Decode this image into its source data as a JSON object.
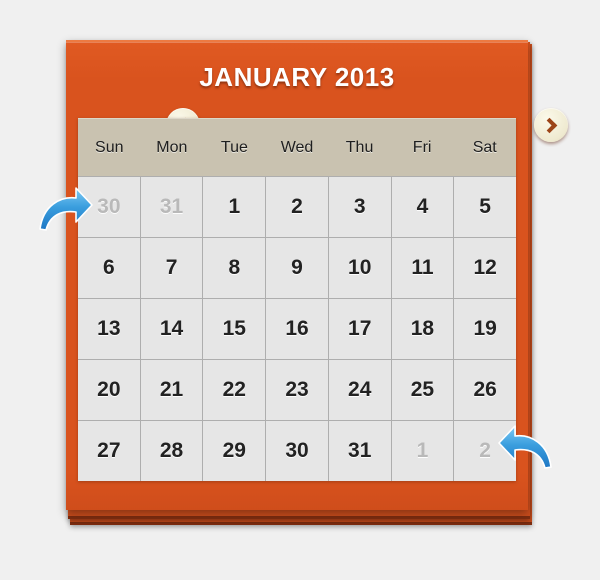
{
  "page": {
    "background_color": "#f0f0f0"
  },
  "calendar": {
    "accent_color": "#d9531e",
    "header": {
      "title": "JANUARY 2013",
      "prev_button_label": "‹",
      "prev_icon": "chevron-left-icon",
      "next_button_label": "›",
      "next_icon": "chevron-right-icon"
    },
    "weekdays": [
      "Sun",
      "Mon",
      "Tue",
      "Wed",
      "Thu",
      "Fri",
      "Sat"
    ],
    "weeks": [
      [
        {
          "day": "30",
          "muted": true
        },
        {
          "day": "31",
          "muted": true
        },
        {
          "day": "1",
          "muted": false
        },
        {
          "day": "2",
          "muted": false
        },
        {
          "day": "3",
          "muted": false
        },
        {
          "day": "4",
          "muted": false
        },
        {
          "day": "5",
          "muted": false
        }
      ],
      [
        {
          "day": "6",
          "muted": false
        },
        {
          "day": "7",
          "muted": false
        },
        {
          "day": "8",
          "muted": false
        },
        {
          "day": "9",
          "muted": false
        },
        {
          "day": "10",
          "muted": false
        },
        {
          "day": "11",
          "muted": false
        },
        {
          "day": "12",
          "muted": false
        }
      ],
      [
        {
          "day": "13",
          "muted": false
        },
        {
          "day": "14",
          "muted": false
        },
        {
          "day": "15",
          "muted": false
        },
        {
          "day": "16",
          "muted": false
        },
        {
          "day": "17",
          "muted": false
        },
        {
          "day": "18",
          "muted": false
        },
        {
          "day": "19",
          "muted": false
        }
      ],
      [
        {
          "day": "20",
          "muted": false
        },
        {
          "day": "21",
          "muted": false
        },
        {
          "day": "22",
          "muted": false
        },
        {
          "day": "23",
          "muted": false
        },
        {
          "day": "24",
          "muted": false
        },
        {
          "day": "25",
          "muted": false
        },
        {
          "day": "26",
          "muted": false
        }
      ],
      [
        {
          "day": "27",
          "muted": false
        },
        {
          "day": "28",
          "muted": false
        },
        {
          "day": "29",
          "muted": false
        },
        {
          "day": "30",
          "muted": false
        },
        {
          "day": "31",
          "muted": false
        },
        {
          "day": "1",
          "muted": true
        },
        {
          "day": "2",
          "muted": true
        }
      ]
    ]
  },
  "annotations": {
    "color": "#2a8fd8",
    "arrows": [
      {
        "name": "arrow-pointing-to-prev-month-day-30",
        "direction": "right"
      },
      {
        "name": "arrow-pointing-to-next-month-day-2",
        "direction": "left"
      }
    ]
  }
}
